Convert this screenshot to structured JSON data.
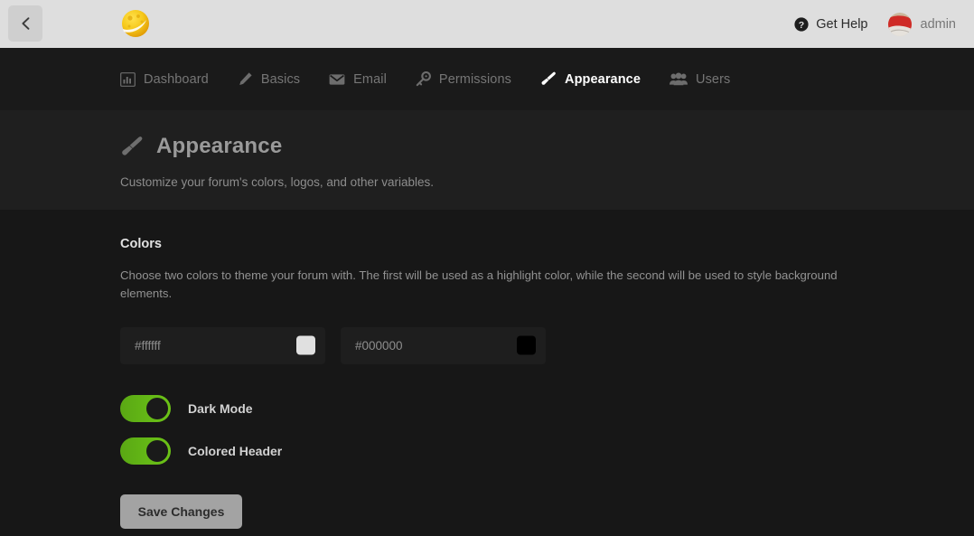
{
  "topbar": {
    "back_button": {
      "icon": "chevron-left-icon",
      "label": ""
    },
    "logo": {
      "icon": "forum-logo-icon",
      "alt": "Forum logo"
    },
    "help": {
      "icon": "question-circle-icon",
      "label": "Get Help"
    },
    "user": {
      "icon": "avatar-icon",
      "name": "admin"
    },
    "background_color": "#dedede"
  },
  "nav": {
    "background_color": "#1a1a1a",
    "active_color": "#ffffff",
    "inactive_color": "#767676",
    "items": [
      {
        "label": "Dashboard",
        "icon": "chart-bar-icon",
        "active": false
      },
      {
        "label": "Basics",
        "icon": "pencil-icon",
        "active": false
      },
      {
        "label": "Email",
        "icon": "envelope-icon",
        "active": false
      },
      {
        "label": "Permissions",
        "icon": "key-icon",
        "active": false
      },
      {
        "label": "Appearance",
        "icon": "paintbrush-icon",
        "active": true
      },
      {
        "label": "Users",
        "icon": "users-icon",
        "active": false
      }
    ]
  },
  "hero": {
    "icon": "paintbrush-icon",
    "title": "Appearance",
    "subtitle": "Customize your forum's colors, logos, and other variables.",
    "background_color": "#1f1f1f"
  },
  "main": {
    "section": {
      "title": "Colors",
      "description": "Choose two colors to theme your forum with. The first will be used as a highlight color, while the second will be used to style background elements."
    },
    "color_fields": [
      {
        "name": "primary-color",
        "value": "",
        "placeholder": "#ffffff",
        "swatch_color": "#e0e0e0"
      },
      {
        "name": "secondary-color",
        "value": "",
        "placeholder": "#000000",
        "swatch_color": "#000000"
      }
    ],
    "toggles": [
      {
        "label": "Dark Mode",
        "on": true,
        "track_color": "#64b816"
      },
      {
        "label": "Colored Header",
        "on": true,
        "track_color": "#64b816"
      }
    ],
    "save_button": {
      "label": "Save Changes",
      "color": "#a3a3a3"
    }
  }
}
